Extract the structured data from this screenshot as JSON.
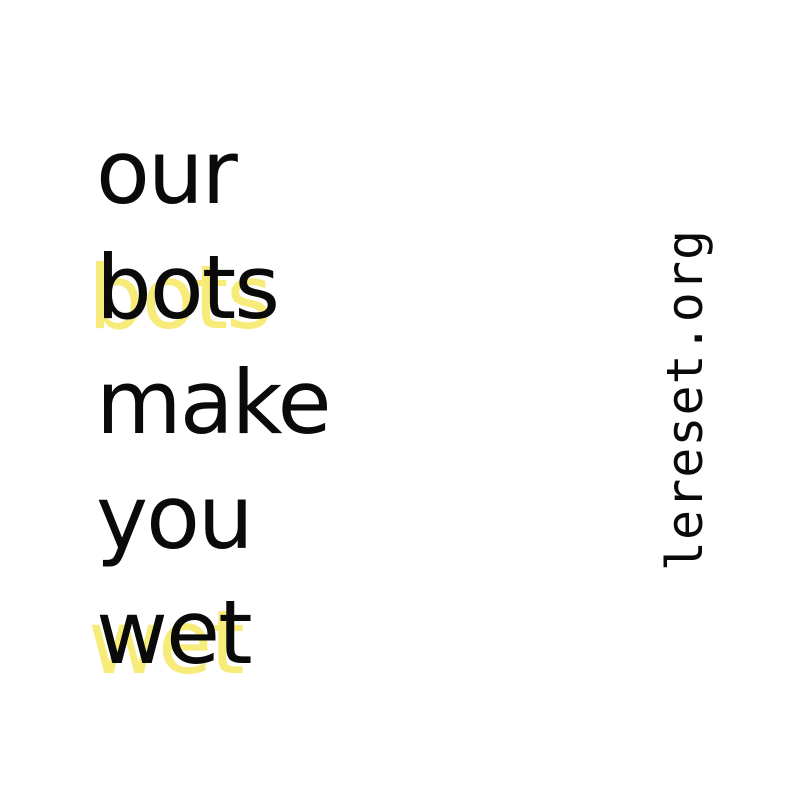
{
  "lines": [
    {
      "text": "our"
    },
    {
      "text": "bots"
    },
    {
      "text": "make"
    },
    {
      "text": "you"
    },
    {
      "text": "wet"
    }
  ],
  "side_url": "lereset.org",
  "colors": {
    "background": "#ffffff",
    "text": "#0a0a0a",
    "highlight": "#f7eb7a"
  }
}
